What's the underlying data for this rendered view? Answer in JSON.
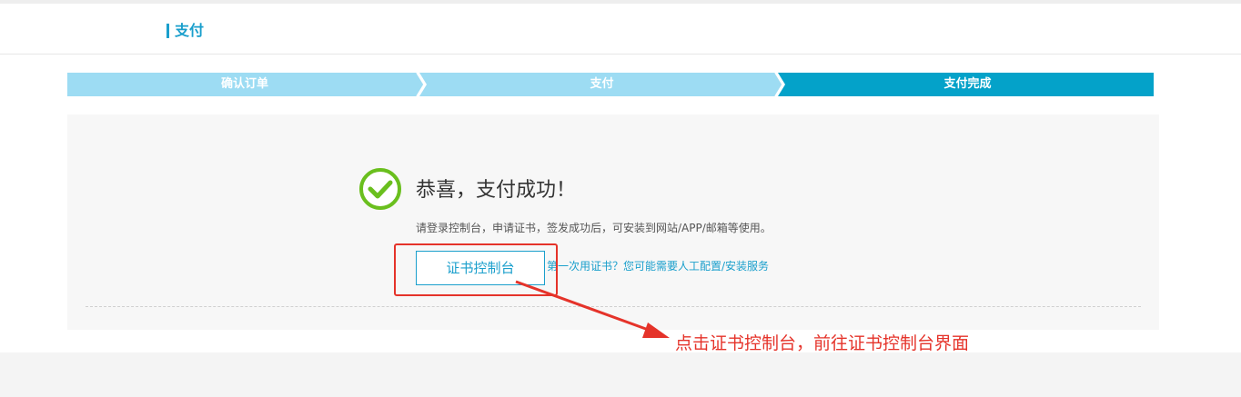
{
  "header": {
    "title": "支付"
  },
  "steps": [
    {
      "label": "确认订单",
      "state": "done"
    },
    {
      "label": "支付",
      "state": "done"
    },
    {
      "label": "支付完成",
      "state": "active"
    }
  ],
  "result": {
    "title": "恭喜，支付成功！",
    "hint": "请登录控制台，申请证书，签发成功后，可安装到网站/APP/邮箱等使用。",
    "console_button": "证书控制台",
    "service_link": "第一次用证书？您可能需要人工配置/安装服务"
  },
  "annotation": {
    "text": "点击证书控制台，前往证书控制台界面"
  },
  "colors": {
    "accent": "#1a9fcc",
    "step_done": "#9ddcf3",
    "step_active": "#04a2c9",
    "success": "#6abf1e",
    "annotation": "#e5332a"
  },
  "icons": {
    "success": "check-circle-icon"
  }
}
